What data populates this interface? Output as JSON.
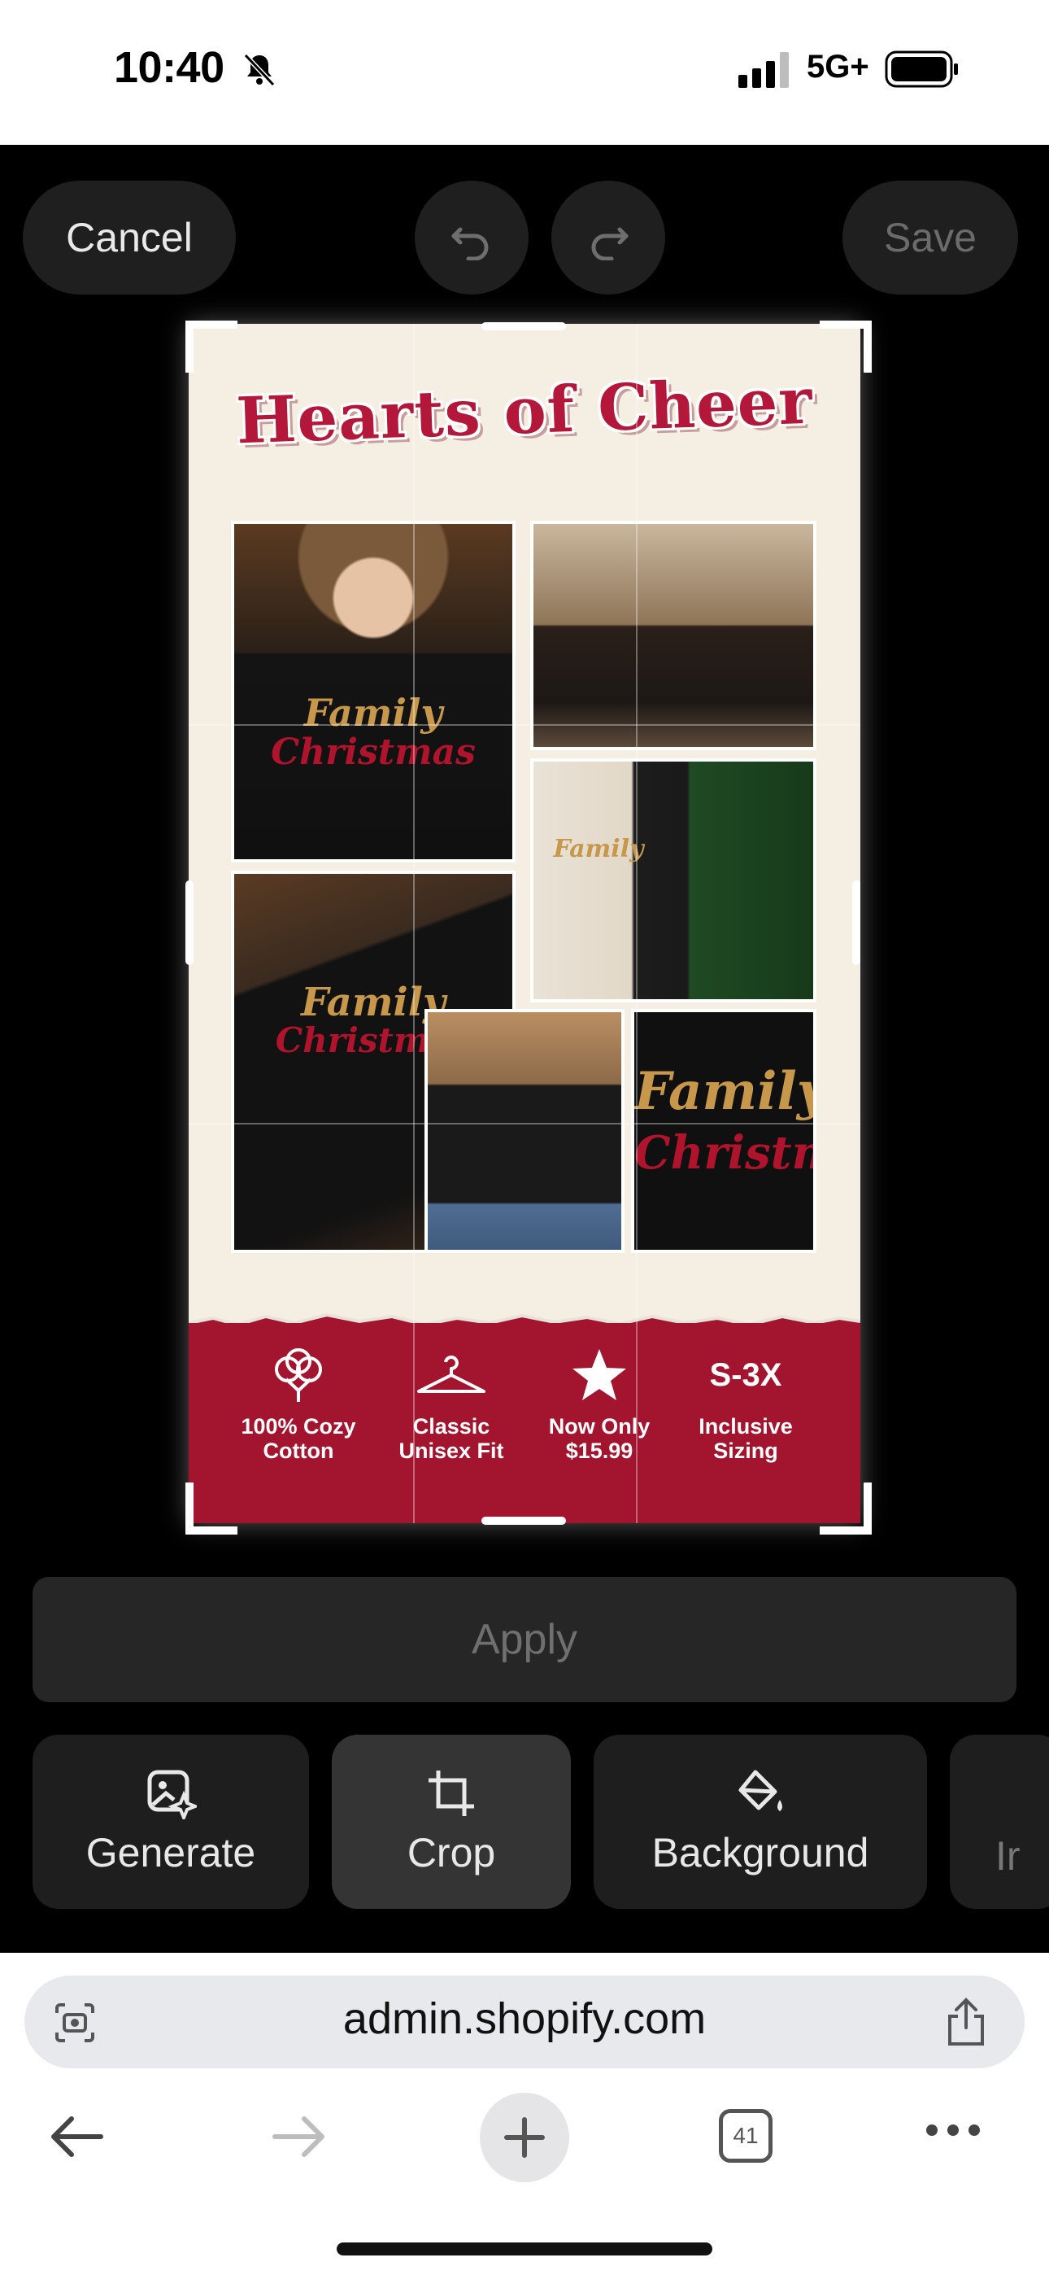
{
  "status_bar": {
    "time": "10:40",
    "network": "5G+"
  },
  "editor": {
    "cancel_label": "Cancel",
    "save_label": "Save",
    "apply_label": "Apply"
  },
  "poster": {
    "title": "Hearts of Cheer",
    "features": [
      {
        "label_line1": "100% Cozy",
        "label_line2": "Cotton",
        "icon": "cotton-icon"
      },
      {
        "label_line1": "Classic",
        "label_line2": "Unisex Fit",
        "icon": "hanger-icon"
      },
      {
        "label_line1": "Now Only",
        "label_line2": "$15.99",
        "icon": "star-icon"
      },
      {
        "label_line1": "Inclusive",
        "label_line2": "Sizing",
        "icon_text": "S-3X"
      }
    ],
    "shirt_word1": "Family",
    "shirt_word2": "Christmas",
    "accent_red": "#a3142f",
    "accent_gold": "#c7984c"
  },
  "tools": [
    {
      "label": "Generate",
      "icon": "generate-image-icon"
    },
    {
      "label": "Crop",
      "icon": "crop-icon"
    },
    {
      "label": "Background",
      "icon": "paint-bucket-icon"
    },
    {
      "label": "Ir",
      "icon": ""
    }
  ],
  "browser": {
    "url": "admin.shopify.com",
    "tab_count": "41"
  }
}
